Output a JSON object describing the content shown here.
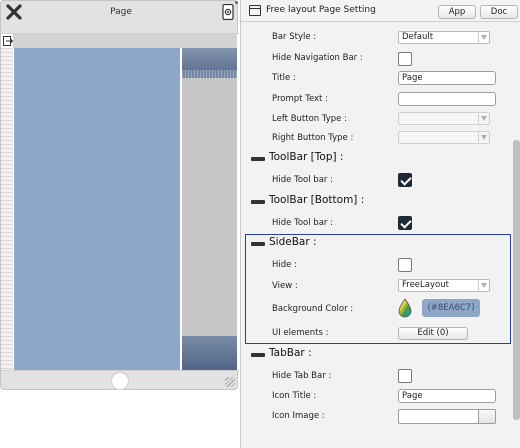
{
  "preview": {
    "title": "Page",
    "sidebar_color": "#8EA6C7"
  },
  "panel": {
    "title": "Free layout Page Setting",
    "app_button": "App",
    "doc_button": "Doc"
  },
  "page_settings": {
    "bar_style": {
      "label": "Bar Style :",
      "value": "Default"
    },
    "hide_navigation_bar": {
      "label": "Hide Navigation Bar :",
      "checked": false
    },
    "title": {
      "label": "Title :",
      "value": "Page"
    },
    "prompt_text": {
      "label": "Prompt Text :",
      "value": ""
    },
    "left_button_type": {
      "label": "Left Button Type :",
      "value": ""
    },
    "right_button_type": {
      "label": "Right Button Type :",
      "value": ""
    }
  },
  "toolbar_top": {
    "heading": "ToolBar [Top] :",
    "hide_label": "Hide Tool bar :",
    "checked": true
  },
  "toolbar_bottom": {
    "heading": "ToolBar [Bottom] :",
    "hide_label": "Hide Tool bar :",
    "checked": true
  },
  "sidebar": {
    "heading": "SideBar :",
    "hide_label": "Hide :",
    "hide_checked": false,
    "view_label": "View :",
    "view_value": "FreeLayout",
    "bg_color_label": "Background Color :",
    "bg_color_value": "(#8EA6C7)",
    "bg_color": "#8EA6C7",
    "ui_elements_label": "UI elements :",
    "ui_elements_button": "Edit (0)"
  },
  "tabbar": {
    "heading": "TabBar :",
    "hide_label": "Hide Tab Bar :",
    "hide_checked": false,
    "icon_title_label": "Icon Title :",
    "icon_title_value": "Page",
    "icon_image_label": "Icon Image :",
    "icon_image_value": ""
  }
}
